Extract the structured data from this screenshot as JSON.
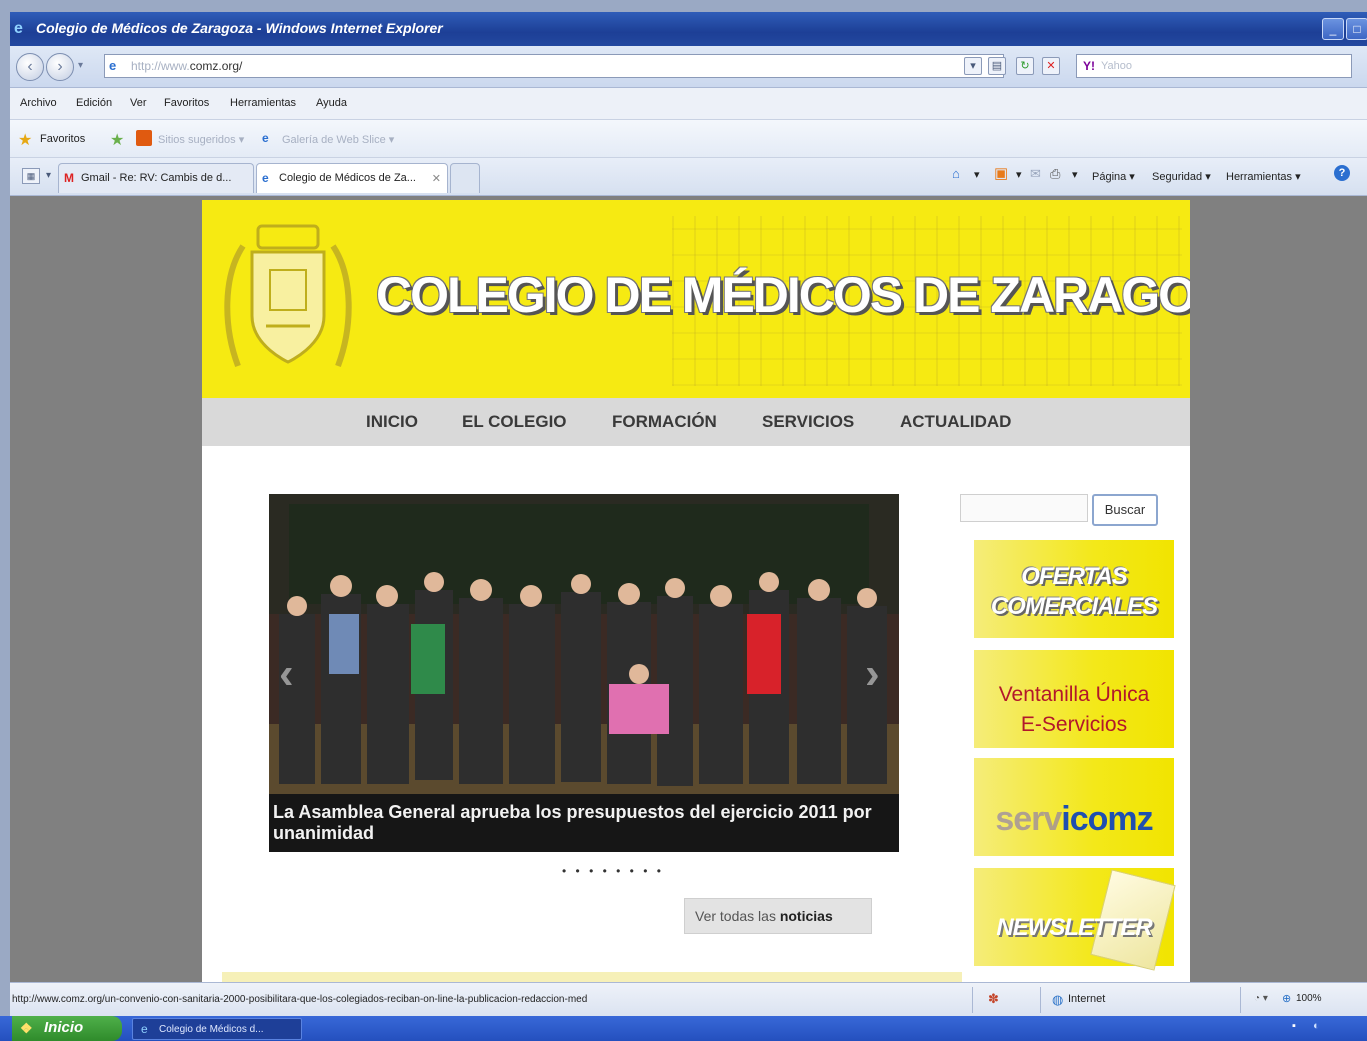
{
  "window": {
    "title": "Colegio de Médicos de Zaragoza - Windows Internet Explorer"
  },
  "address_bar": {
    "url_prefix": "http://www.",
    "url_domain": "comz.org/",
    "search_engine": "Y!",
    "search_placeholder": "Yahoo"
  },
  "menu": [
    "Archivo",
    "Edición",
    "Ver",
    "Favoritos",
    "Herramientas",
    "Ayuda"
  ],
  "favorites_bar": {
    "label": "Favoritos",
    "suggested_sites": "Sitios sugeridos ▾",
    "web_slice": "Galería de Web Slice ▾"
  },
  "tabs": [
    {
      "label": "Gmail - Re: RV: Cambis de d..."
    },
    {
      "label": "Colegio de Médicos de Za...",
      "close": "✕"
    }
  ],
  "command_bar": {
    "page": "Página ▾",
    "safety": "Seguridad ▾",
    "tools": "Herramientas ▾"
  },
  "site": {
    "title": "COLEGIO DE MÉDICOS DE ZARAGOZA",
    "nav": [
      "INICIO",
      "EL COLEGIO",
      "FORMACIÓN",
      "SERVICIOS",
      "ACTUALIDAD"
    ],
    "slider": {
      "caption": "La Asamblea General aprueba los presupuestos del ejercicio 2011 por unanimidad",
      "prev_arrow": "‹",
      "next_arrow": "›",
      "dots": "• • • • • • • •"
    },
    "all_news": {
      "prefix": "Ver todas las ",
      "bold": "noticias"
    },
    "search": {
      "button": "Buscar"
    },
    "promos": {
      "ofertas": [
        "OFERTAS",
        "COMERCIALES"
      ],
      "ventanilla": [
        "Ventanilla Única",
        "E-Servicios"
      ],
      "servicomz": {
        "serv": "serv",
        "i": "i",
        "comz": "comz"
      },
      "newsletter": "NEWSLETTER"
    }
  },
  "status_bar": {
    "url": "http://www.comz.org/un-convenio-con-sanitaria-2000-posibilitara-que-los-colegiados-reciban-on-line-la-publicacion-redaccion-med",
    "zone": "Internet",
    "zoom": "100%"
  },
  "taskbar": {
    "start": "Inicio",
    "item": "Colegio de Médicos d..."
  },
  "colors": {
    "banner_yellow": "#f6ea12",
    "nav_gray": "#d9d9d9",
    "ventanilla_red": "#b2172b",
    "comz_blue": "#1f4fb0"
  }
}
